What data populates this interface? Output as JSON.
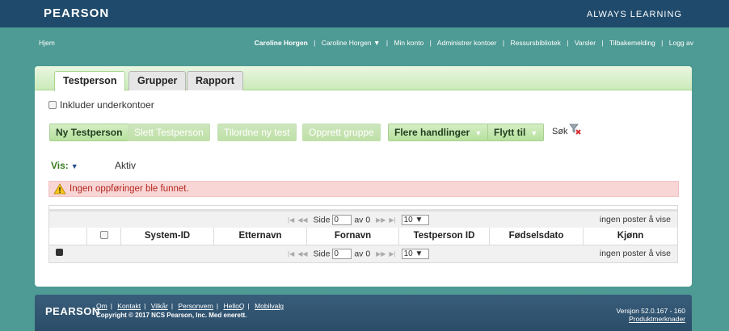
{
  "header": {
    "brand": "PEARSON",
    "tagline": "ALWAYS LEARNING"
  },
  "nav": {
    "home": "Hjem",
    "user_display": "Caroline Horgen",
    "separator": "|",
    "user_menu": "Caroline Horgen",
    "user_menu_icon": "chevron-down-icon",
    "items": [
      "Min konto",
      "Administrer kontoer",
      "Ressursbibliotek",
      "Varsler",
      "Tilbakemelding",
      "Logg av"
    ]
  },
  "tabs": [
    {
      "label": "Testperson",
      "active": true
    },
    {
      "label": "Grupper",
      "active": false
    },
    {
      "label": "Rapport",
      "active": false
    }
  ],
  "include_subaccounts": {
    "label": "Inkluder underkontoer",
    "checked": false
  },
  "toolbar": {
    "new_label": "Ny Testperson",
    "delete_label": "Slett Testperson",
    "assign_label": "Tilordne ny test",
    "create_group_label": "Opprett gruppe",
    "more_actions_label": "Flere handlinger",
    "move_to_label": "Flytt til",
    "search_label": "Søk",
    "search_icon": "filter-clear-icon"
  },
  "view": {
    "label": "Vis:",
    "value": "Aktiv"
  },
  "alert": {
    "message": "Ingen oppføringer ble funnet.",
    "icon": "warning-icon",
    "color": "#b3261e"
  },
  "grid": {
    "pager": {
      "page_label": "Side",
      "page_value": "0",
      "of_label": "av 0",
      "page_size": "10",
      "info": "ingen poster å vise"
    },
    "columns": [
      "System-ID",
      "Etternavn",
      "Fornavn",
      "Testperson ID",
      "Fødselsdato",
      "Kjønn"
    ]
  },
  "footer": {
    "brand": "PEARSON",
    "links": [
      "Om",
      "Kontakt",
      "Vilkår",
      "Personvern",
      "HelloQ",
      "Mobilvalg"
    ],
    "copyright": "Copyright © 2017 NCS Pearson, Inc. Med enerett.",
    "version": "Versjon 52.0.167 - 160",
    "release_notes": "Produktmerknader"
  },
  "colors": {
    "topbar": "#1f4a6b",
    "background": "#4e9a94",
    "accent_green": "#b7e09d",
    "footer": "#2f5270"
  }
}
